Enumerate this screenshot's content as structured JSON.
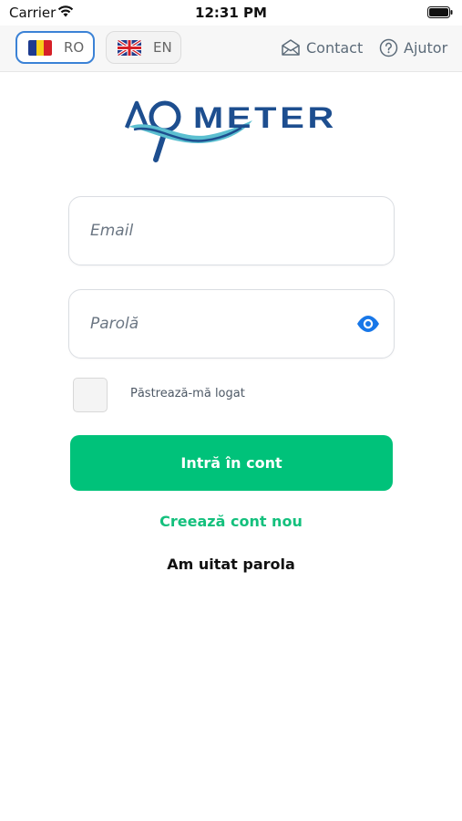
{
  "status_bar": {
    "carrier": "Carrier",
    "time": "12:31 PM"
  },
  "nav": {
    "languages": [
      {
        "code": "RO",
        "selected": true,
        "flag": "romania-flag"
      },
      {
        "code": "EN",
        "selected": false,
        "flag": "uk-flag"
      }
    ],
    "contact_label": "Contact",
    "help_label": "Ajutor"
  },
  "logo": {
    "text": "AQMETER"
  },
  "form": {
    "email_placeholder": "Email",
    "password_placeholder": "Parolă",
    "remember_label": "Păstrează-mă logat",
    "remember_checked": false,
    "login_label": "Intră în cont"
  },
  "links": {
    "create_account": "Creează cont nou",
    "forgot_password": "Am uitat parola"
  },
  "colors": {
    "accent_green": "#00c27a",
    "selected_border": "#3b82d6",
    "eye_icon": "#1877e8",
    "logo_blue": "#1d4e8f",
    "logo_teal": "#5bbfd0"
  }
}
